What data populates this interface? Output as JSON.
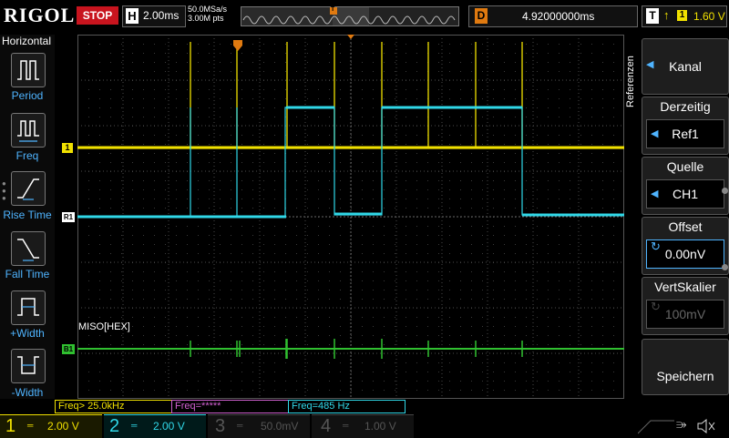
{
  "header": {
    "logo": "RIGOL",
    "run_state": "STOP",
    "timebase_key": "H",
    "timebase_value": "2.00ms",
    "sample_rate": "50.0MSa/s",
    "memory_depth": "3.00M pts",
    "trigger_marker": "T",
    "delay_key": "D",
    "delay_value": "4.92000000ms",
    "trigger_key": "T",
    "trigger_source": "1",
    "trigger_level": "1.60 V"
  },
  "left_menu": {
    "title": "Horizontal",
    "items": [
      {
        "label": "Period",
        "icon": "period-icon"
      },
      {
        "label": "Freq",
        "icon": "freq-icon"
      },
      {
        "label": "Rise Time",
        "icon": "rise-time-icon"
      },
      {
        "label": "Fall Time",
        "icon": "fall-time-icon"
      },
      {
        "label": "+Width",
        "icon": "pos-width-icon"
      },
      {
        "label": "-Width",
        "icon": "neg-width-icon"
      }
    ]
  },
  "waveform": {
    "ch1_marker": "1",
    "ref_marker": "R1",
    "bus_marker": "B1",
    "bus_label": "MISO[HEX]",
    "trigger_marker": "T"
  },
  "right_menu": {
    "vertical_title": "Referenzen",
    "items": [
      {
        "title": "",
        "value": "Kanal"
      },
      {
        "title": "Derzeitig",
        "value": "Ref1"
      },
      {
        "title": "Quelle",
        "value": "CH1"
      },
      {
        "title": "Offset",
        "value": "0.00nV"
      },
      {
        "title": "VertSkalier",
        "value": "100mV"
      },
      {
        "title": "",
        "value": "Speichern"
      }
    ]
  },
  "measurements": [
    {
      "text": "Freq> 25.0kHz",
      "color": "#f0e000"
    },
    {
      "text": "Freq=*****",
      "color": "#d060d0"
    },
    {
      "text": "Freq=485 Hz",
      "color": "#30d8e8"
    }
  ],
  "channels": [
    {
      "num": "1",
      "value": "2.00 V",
      "color": "#f0e000"
    },
    {
      "num": "2",
      "value": "2.00 V",
      "color": "#30d8e8"
    },
    {
      "num": "3",
      "value": "50.0mV",
      "color": "#d060d0"
    },
    {
      "num": "4",
      "value": "1.00 V",
      "color": "#3070ff"
    }
  ],
  "colors": {
    "ch1": "#f0e000",
    "ref": "#30d8e8",
    "bus": "#30c030",
    "accent": "#4fb4ff",
    "stop": "#c8141e",
    "trigger": "#e07a10"
  }
}
